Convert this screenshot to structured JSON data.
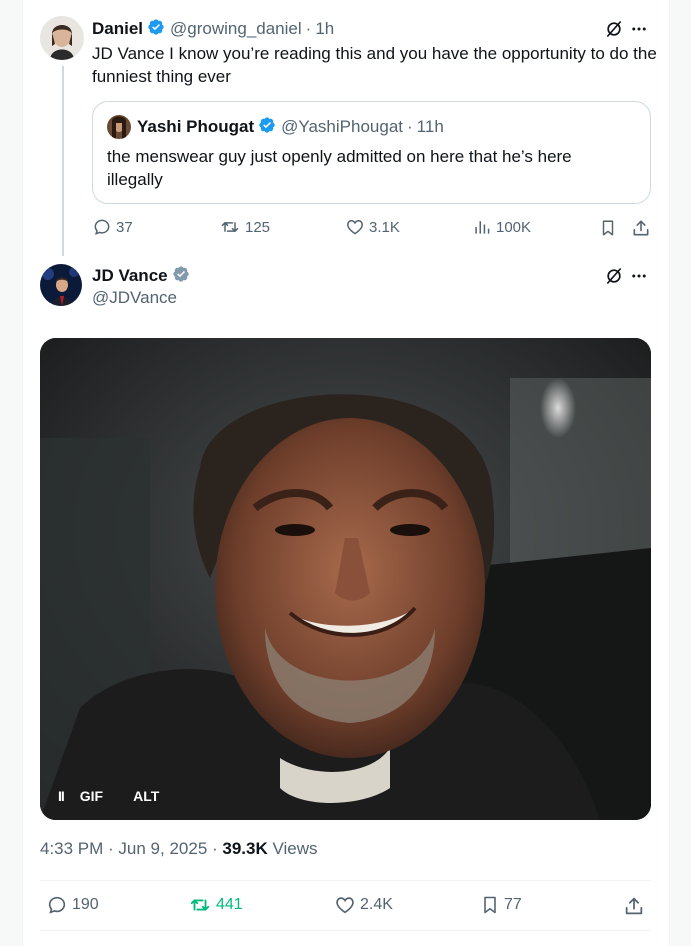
{
  "parent_tweet": {
    "author_name": "Daniel",
    "author_handle": "@growing_daniel",
    "separator": "·",
    "time": "1h",
    "text": "JD Vance I know you’re reading this and you have the opportunity to do the funniest thing ever",
    "quoted": {
      "author_name": "Yashi Phougat",
      "author_handle": "@YashiPhougat",
      "separator": "·",
      "time": "11h",
      "text": "the menswear guy just openly admitted on here that he’s here illegally"
    },
    "actions": {
      "replies": "37",
      "reposts": "125",
      "likes": "3.1K",
      "views": "100K"
    }
  },
  "main_tweet": {
    "author_name": "JD Vance",
    "author_handle": "@JDVance",
    "media": {
      "pause_label": "II",
      "gif_label": "GIF",
      "alt_label": "ALT"
    },
    "timestamp": "4:33 PM · Jun 9, 2025 · ",
    "views_count": "39.3K",
    "views_label": " Views",
    "actions": {
      "replies": "190",
      "reposts": "441",
      "likes": "2.4K",
      "bookmarks": "77"
    }
  },
  "colors": {
    "verified_blue": "#1d9bf0",
    "verified_gray": "#829aab",
    "repost_green": "#00ba7c",
    "text_secondary": "#536471"
  },
  "icons": [
    "grok-icon",
    "more-icon",
    "reply-icon",
    "repost-icon",
    "like-icon",
    "views-icon",
    "bookmark-icon",
    "share-icon"
  ]
}
